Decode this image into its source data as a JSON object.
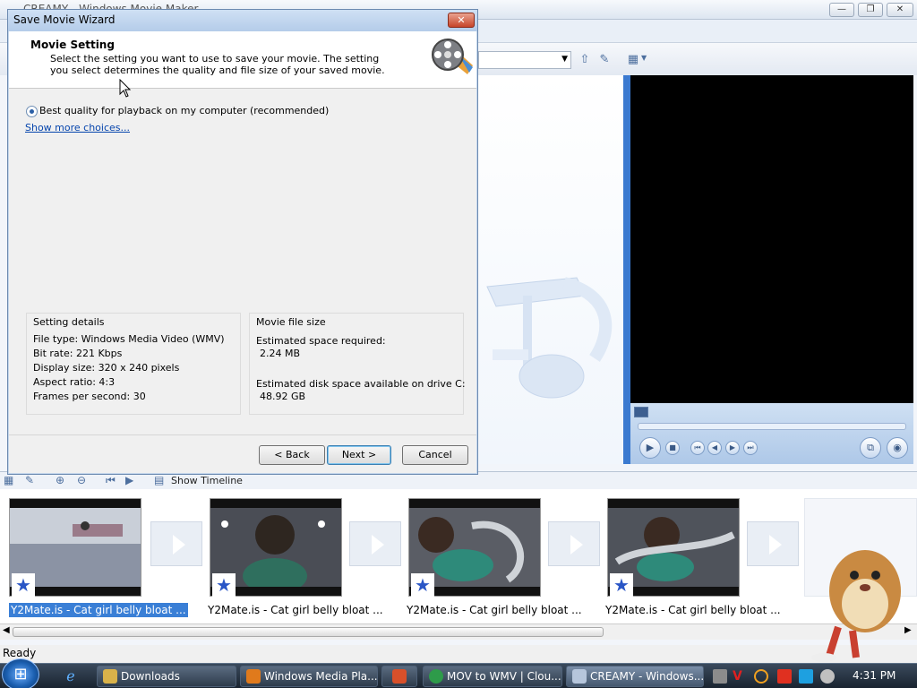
{
  "app": {
    "title": "CREAMY - Windows Movie Maker",
    "status": "Ready",
    "story_toolbar": {
      "show_timeline": "Show Timeline"
    }
  },
  "dialog": {
    "title": "Save Movie Wizard",
    "close": "✕",
    "heading": "Movie Setting",
    "description": "Select the setting you want to use to save your movie. The setting you select determines the quality and file size of your saved movie.",
    "option": "Best quality for playback on my computer (recommended)",
    "show_more": "Show more choices...",
    "setting_details": {
      "title": "Setting details",
      "file_type": "File type: Windows Media Video (WMV)",
      "bit_rate": "Bit rate: 221 Kbps",
      "display_size": "Display size: 320 x 240 pixels",
      "aspect_ratio": "Aspect ratio: 4:3",
      "fps": "Frames per second: 30"
    },
    "movie_file_size": {
      "title": "Movie file size",
      "est_label": "Estimated space required:",
      "est_value": "2.24 MB",
      "disk_label": "Estimated disk space available on drive C:",
      "disk_value": "48.92 GB"
    },
    "buttons": {
      "back": "< Back",
      "next": "Next >",
      "cancel": "Cancel"
    }
  },
  "storyboard": {
    "clips": [
      {
        "caption": "Y2Mate.is - Cat girl belly bloat ...",
        "selected": true
      },
      {
        "caption": "Y2Mate.is - Cat girl belly bloat ...",
        "selected": false
      },
      {
        "caption": "Y2Mate.is - Cat girl belly bloat ...",
        "selected": false
      },
      {
        "caption": "Y2Mate.is - Cat girl belly bloat ...",
        "selected": false
      }
    ]
  },
  "taskbar": {
    "items": [
      {
        "label": "Downloads",
        "icon": "folder-icon",
        "color": "#d9b24a"
      },
      {
        "label": "Windows Media Pla...",
        "icon": "media-player-icon",
        "color": "#e07a1c"
      },
      {
        "label": "",
        "icon": "paint-icon",
        "color": "#d8502a"
      },
      {
        "label": "MOV to WMV | Clou...",
        "icon": "chrome-icon",
        "color": "#2e9b4a"
      },
      {
        "label": "CREAMY - Windows...",
        "icon": "movie-maker-icon",
        "color": "#b6c6dc"
      }
    ],
    "clock": "4:31 PM"
  }
}
